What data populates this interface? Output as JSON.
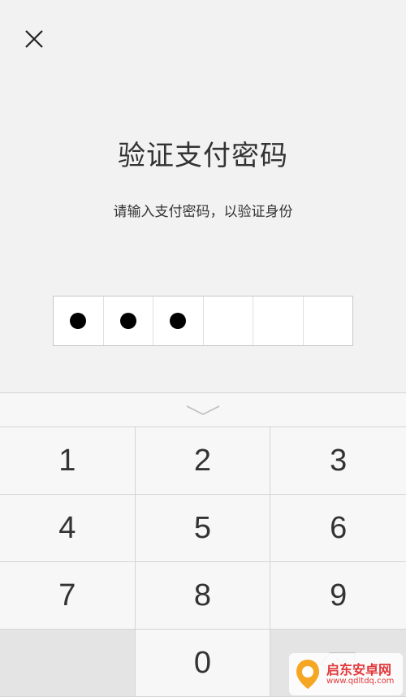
{
  "header": {
    "close_icon": "close-icon",
    "title": "验证支付密码",
    "subtitle": "请输入支付密码，以验证身份"
  },
  "pin": {
    "length": 6,
    "filled": 3
  },
  "keyboard": {
    "collapse_icon": "chevron-down-icon",
    "keys": [
      "1",
      "2",
      "3",
      "4",
      "5",
      "6",
      "7",
      "8",
      "9",
      "",
      "0",
      "backspace"
    ],
    "delete_icon": "backspace-icon"
  },
  "watermark": {
    "name": "启东安卓网",
    "url": "www.qdltdq.com"
  },
  "colors": {
    "background": "#f2f2f2",
    "keyboard_bg": "#f7f7f7",
    "key_dark_bg": "#e4e4e4",
    "watermark_red": "#e2373a"
  }
}
